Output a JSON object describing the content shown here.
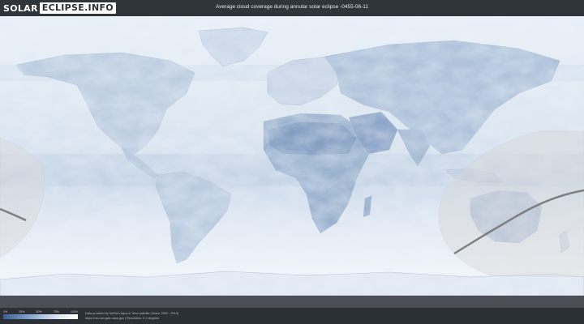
{
  "header": {
    "logo_left": "SOLAR",
    "logo_right": "ECLIPSE.INFO",
    "title": "Average cloud coverage during annular solar eclipse -0455-06-11"
  },
  "legend": {
    "labels": [
      "0%",
      "25%",
      "50%",
      "75%",
      "100%"
    ],
    "colors": [
      "#3d5f8f",
      "#6f8fb8",
      "#a9c0db",
      "#dfe8f2",
      "#ffffff"
    ]
  },
  "credits": {
    "line1": "Data provided by NASA's Aqua & Terra satellite (Years: 2000 - 2019)",
    "line2": "https://neo.sci.gsfc.nasa.gov | Resolution: 0.1 degrees"
  },
  "map": {
    "eclipse_path_color": "#6e6e6e",
    "visibility_zone_color": "#d9d9d9"
  }
}
